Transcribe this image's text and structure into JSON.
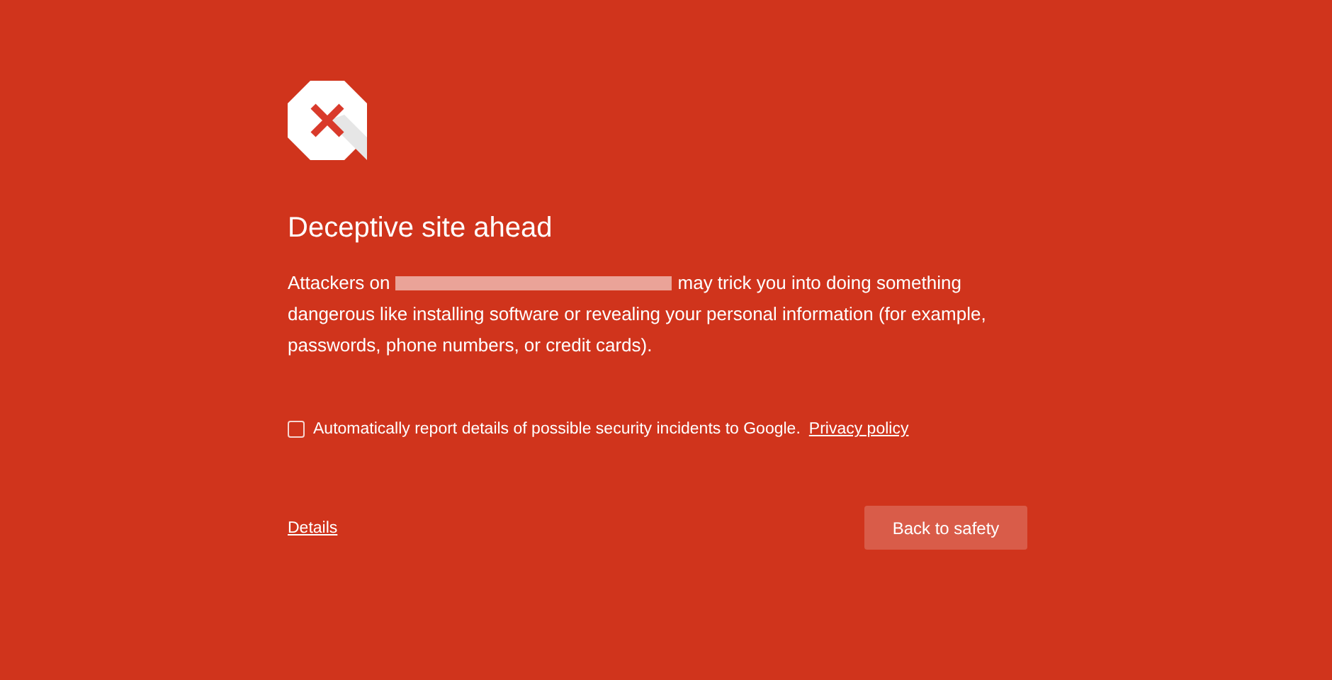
{
  "heading": "Deceptive site ahead",
  "message": {
    "before": "Attackers on",
    "after": "may trick you into doing something",
    "continued": "dangerous like installing software or revealing your personal information (for example, passwords, phone numbers, or credit cards)."
  },
  "report": {
    "checked": false,
    "label": "Automatically report details of possible security incidents to Google.",
    "link": "Privacy policy"
  },
  "details_link": "Details",
  "primary_button": "Back to safety"
}
